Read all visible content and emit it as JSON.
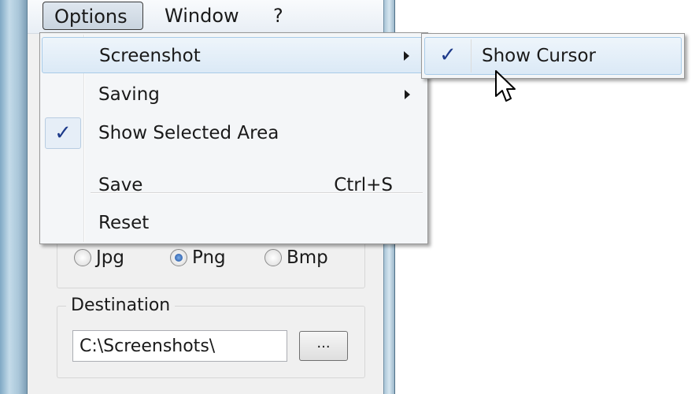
{
  "menubar": {
    "items": [
      {
        "label": "Options"
      },
      {
        "label": "Window"
      },
      {
        "label": "?"
      }
    ]
  },
  "options_menu": {
    "items": [
      {
        "label": "Screenshot",
        "has_submenu": true
      },
      {
        "label": "Saving",
        "has_submenu": true
      },
      {
        "label": "Show Selected Area",
        "checked": true
      },
      {
        "label": "Save",
        "shortcut": "Ctrl+S"
      },
      {
        "label": "Reset"
      }
    ]
  },
  "screenshot_submenu": {
    "items": [
      {
        "label": "Show Cursor",
        "checked": true,
        "check_glyph": "✓"
      }
    ]
  },
  "check_glyph": "✓",
  "format": {
    "options": [
      {
        "label": "Jpg",
        "selected": false
      },
      {
        "label": "Png",
        "selected": true
      },
      {
        "label": "Bmp",
        "selected": false
      }
    ]
  },
  "destination": {
    "label": "Destination",
    "path": "C:\\Screenshots\\",
    "browse_label": "..."
  },
  "colors": {
    "highlight": "#dbe9f6",
    "checkmark": "#1d3a8a",
    "radio_selected": "#1a4a9a"
  }
}
